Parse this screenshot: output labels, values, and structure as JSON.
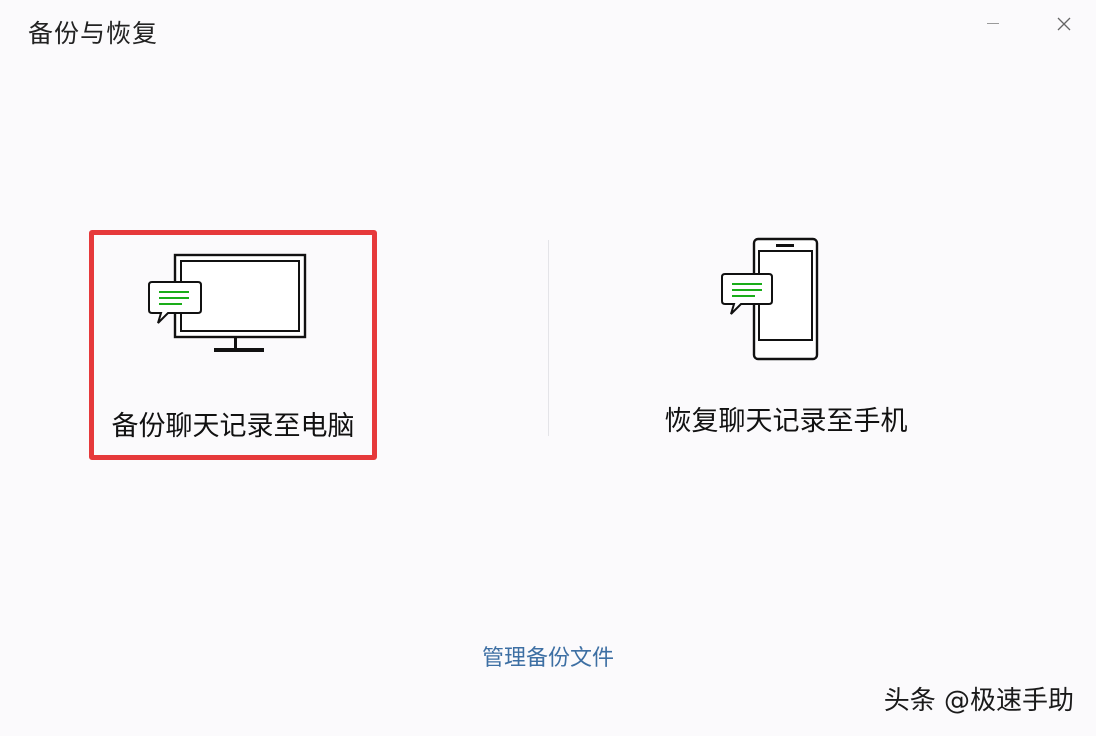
{
  "window": {
    "title": "备份与恢复"
  },
  "controls": {
    "minimize_icon": "minimize-icon",
    "close_icon": "close-icon"
  },
  "options": [
    {
      "label": "备份聊天记录至电脑",
      "icon": "monitor-chat-icon",
      "selected": true
    },
    {
      "label": "恢复聊天记录至手机",
      "icon": "phone-chat-icon",
      "selected": false
    }
  ],
  "footer": {
    "manage_link": "管理备份文件"
  },
  "watermark": {
    "text": "头条 @极速手助"
  },
  "colors": {
    "highlight_border": "#e6393b",
    "chat_lines": "#1aad19",
    "link": "#3d6fa3",
    "background": "#fbfafc"
  }
}
